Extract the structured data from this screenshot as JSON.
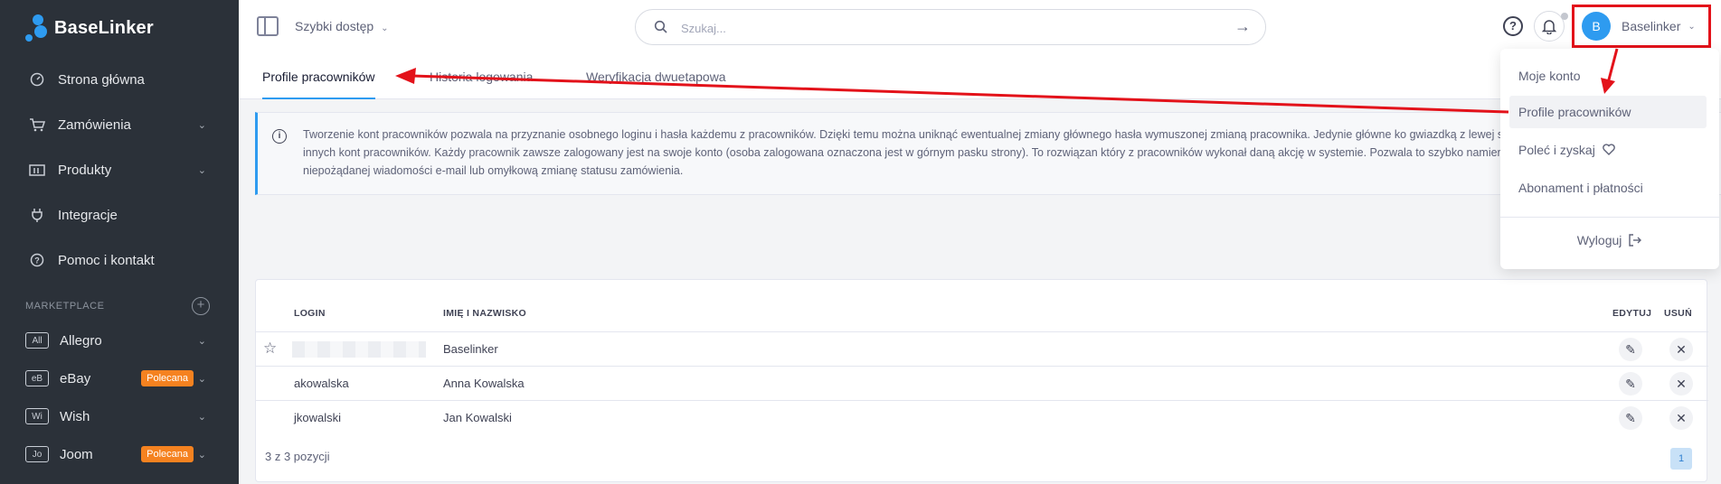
{
  "app": {
    "logo_text": "BaseLinker"
  },
  "sidebar": {
    "items": [
      {
        "label": "Strona główna",
        "icon": "dashboard-icon"
      },
      {
        "label": "Zamówienia",
        "icon": "cart-icon"
      },
      {
        "label": "Produkty",
        "icon": "products-icon"
      },
      {
        "label": "Integracje",
        "icon": "plug-icon"
      },
      {
        "label": "Pomoc i kontakt",
        "icon": "help-icon"
      }
    ],
    "marketplace_title": "MARKETPLACE",
    "marketplaces": [
      {
        "badge": "All",
        "label": "Allegro",
        "tag": ""
      },
      {
        "badge": "eB",
        "label": "eBay",
        "tag": "Polecana"
      },
      {
        "badge": "Wi",
        "label": "Wish",
        "tag": ""
      },
      {
        "badge": "Jo",
        "label": "Joom",
        "tag": "Polecana"
      }
    ]
  },
  "header": {
    "quick_access": "Szybki dostęp",
    "search_placeholder": "Szukaj...",
    "help_glyph": "?",
    "user": {
      "initial": "B",
      "name": "Baselinker"
    }
  },
  "tabs": [
    {
      "label": "Profile pracowników",
      "active": true
    },
    {
      "label": "Historia logowania",
      "active": false
    },
    {
      "label": "Weryfikacja dwuetapowa",
      "active": false
    }
  ],
  "info": {
    "text": "Tworzenie kont pracowników pozwala na przyznanie osobnego loginu i hasła każdemu z pracowników. Dzięki temu można uniknąć ewentualnej zmiany głównego hasła wymuszonej zmianą pracownika. Jedynie główne ko gwiazdką z lewej strony tabeli) może tworzyć i edytować dane innych kont pracowników. Każdy pracownik zawsze zalogowany jest na swoje konto (osoba zalogowana oznaczona jest w górnym pasku strony). To rozwiązan który z pracowników wykonał daną akcję w systemie. Pozwala to szybko namierzyć osobę odpowiedzialną za wysłanie niepożądanej wiadomości e-mail lub omyłkową zmianę statusu zamówienia."
  },
  "table": {
    "columns": {
      "login": "LOGIN",
      "name": "IMIĘ I NAZWISKO",
      "edit": "EDYTUJ",
      "delete": "USUŃ"
    },
    "rows": [
      {
        "login": "",
        "name": "Baselinker",
        "starred": true
      },
      {
        "login": "akowalska",
        "name": "Anna Kowalska",
        "starred": false
      },
      {
        "login": "jkowalski",
        "name": "Jan Kowalski",
        "starred": false
      }
    ],
    "footer": "3 z 3 pozycji",
    "page": "1"
  },
  "dropdown": {
    "items": [
      {
        "label": "Moje konto"
      },
      {
        "label": "Profile pracowników"
      },
      {
        "label": "Poleć i zyskaj"
      },
      {
        "label": "Abonament i płatności"
      }
    ],
    "logout": "Wyloguj"
  },
  "colors": {
    "sidebar_bg": "#2b3139",
    "accent": "#2e9bf0",
    "badge_orange": "#f58220",
    "annotation_red": "#e3121a"
  }
}
